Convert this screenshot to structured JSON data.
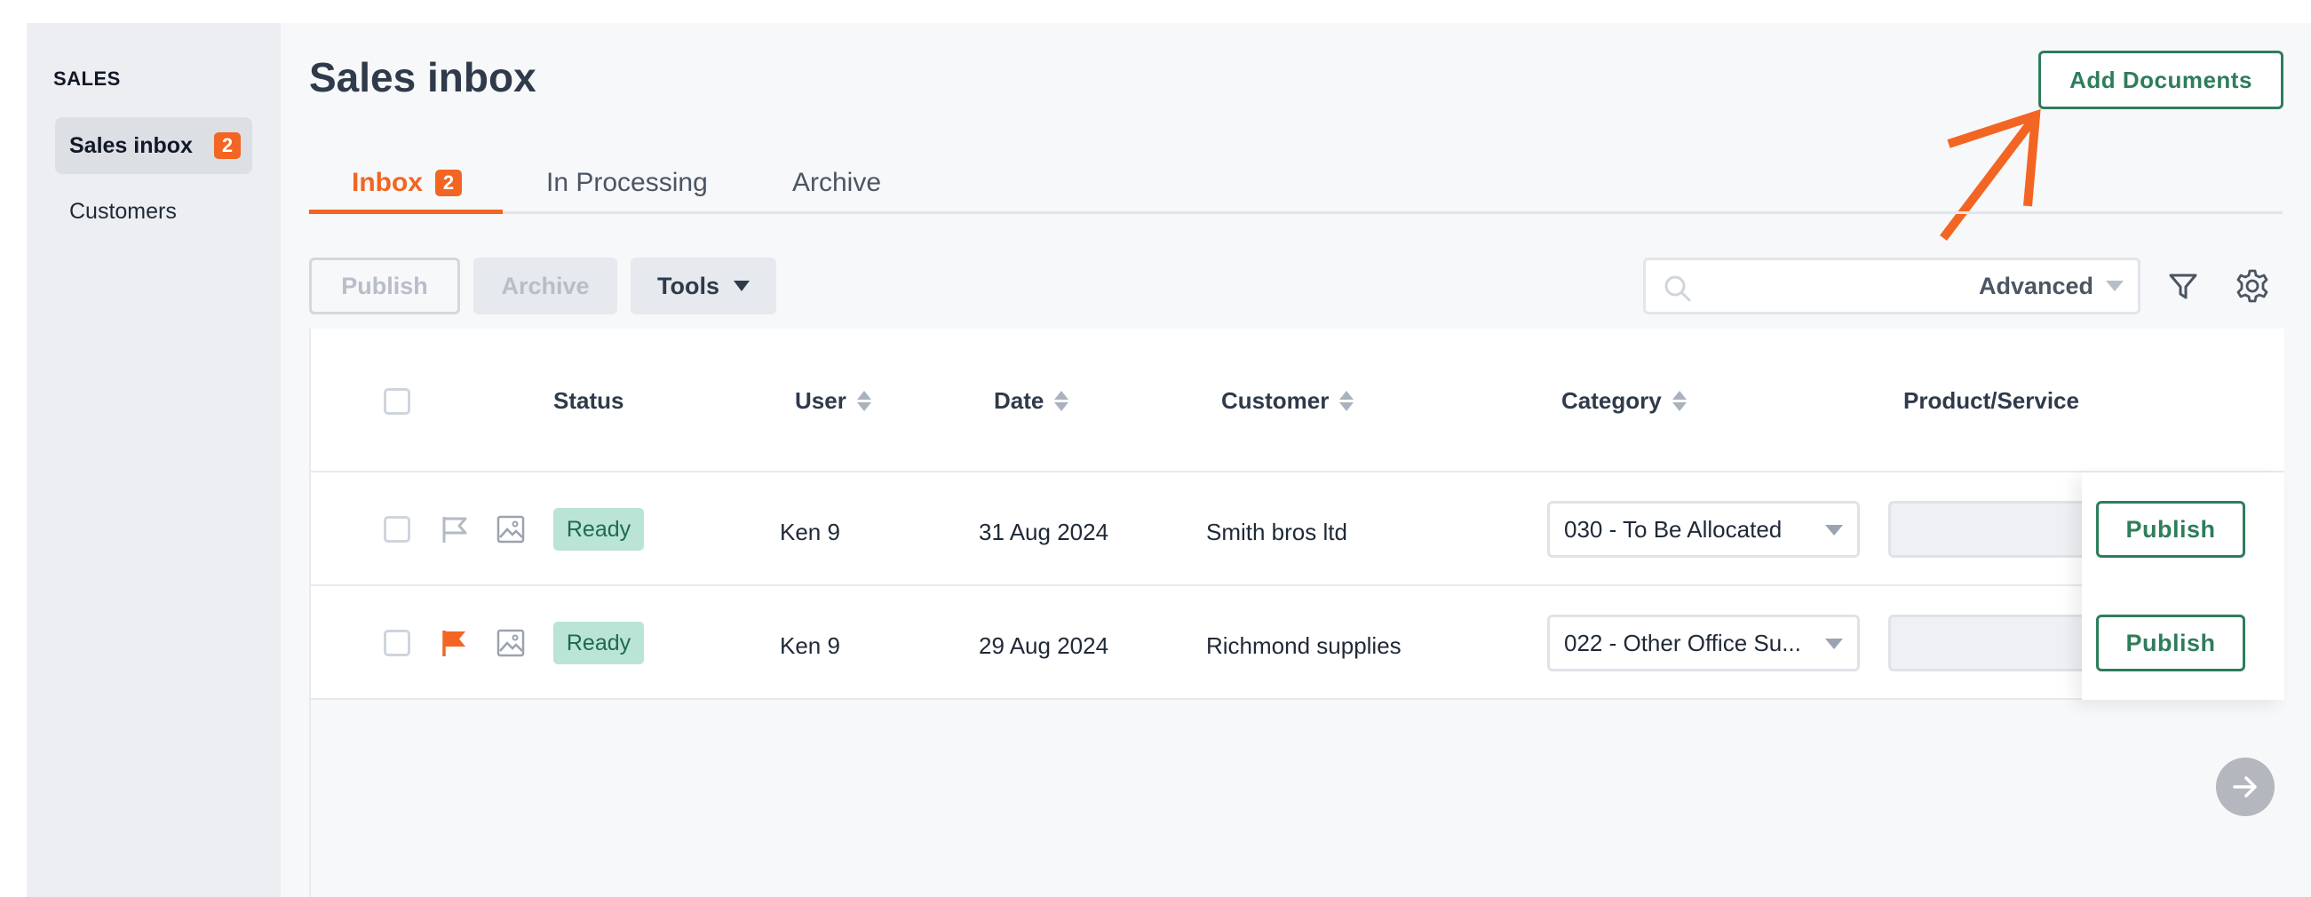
{
  "sidebar": {
    "section_title": "SALES",
    "items": [
      {
        "label": "Sales inbox",
        "badge": "2",
        "active": true
      },
      {
        "label": "Customers"
      }
    ]
  },
  "header": {
    "title": "Sales inbox",
    "add_documents_label": "Add Documents"
  },
  "tabs": [
    {
      "label": "Inbox",
      "badge": "2",
      "active": true
    },
    {
      "label": "In Processing"
    },
    {
      "label": "Archive"
    }
  ],
  "toolbar": {
    "publish_label": "Publish",
    "archive_label": "Archive",
    "tools_label": "Tools",
    "search_placeholder": "",
    "search_value": "",
    "advanced_label": "Advanced"
  },
  "table": {
    "columns": [
      "Status",
      "User",
      "Date",
      "Customer",
      "Category",
      "Product/Service"
    ],
    "rows": [
      {
        "status": "Ready",
        "user": "Ken 9",
        "date": "31 Aug 2024",
        "customer": "Smith bros ltd",
        "category": "030 - To Be Allocated",
        "product": "",
        "flagged": false,
        "action": "Publish"
      },
      {
        "status": "Ready",
        "user": "Ken 9",
        "date": "29 Aug 2024",
        "customer": "Richmond supplies",
        "category": "022 - Other Office Su...",
        "product": "",
        "flagged": true,
        "action": "Publish"
      }
    ]
  },
  "colors": {
    "accent": "#f26522",
    "primary": "#2e7d5b",
    "status_ready_bg": "#b9e4d6"
  }
}
